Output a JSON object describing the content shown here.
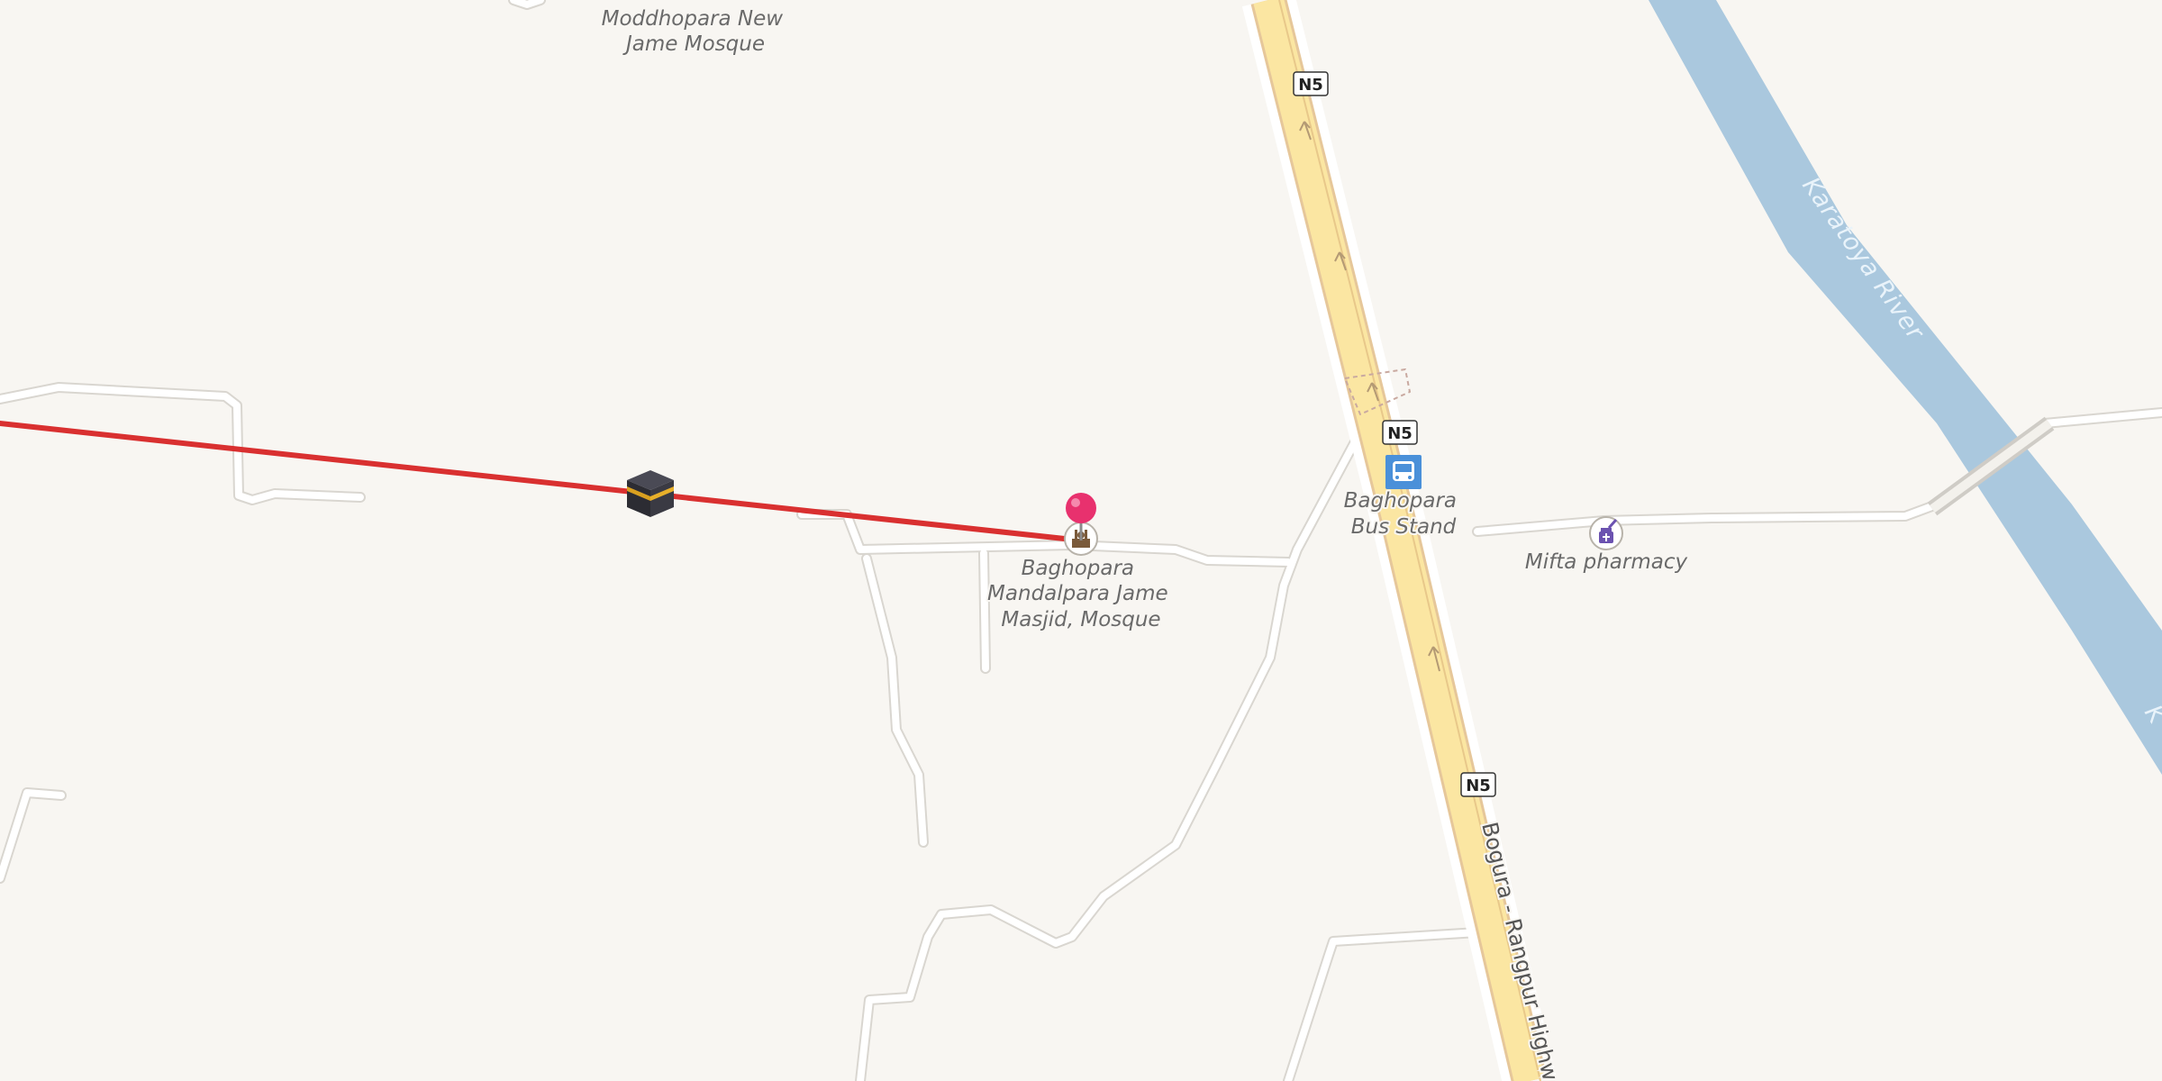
{
  "map": {
    "pois": {
      "moddhopara_mosque": "Moddhopara New Jame Mosque",
      "mandalpara_masjid": "Baghopara Mandalpara Jame Masjid, Mosque",
      "bus_stand": "Baghopara Bus Stand",
      "pharmacy": "Mifta pharmacy"
    },
    "road_names": {
      "highway": "Bogura - Rangpur Highway"
    },
    "road_refs": {
      "ref_top": "N5",
      "ref_mid": "N5",
      "ref_bottom": "N5"
    },
    "water": {
      "river": "Karatoya River",
      "river_edge": "K"
    },
    "icons": {
      "kaaba_marker": "kaaba-icon",
      "pin": "map-pin-icon",
      "mosque": "mosque-icon",
      "bus": "bus-icon",
      "pharmacy": "pharmacy-icon"
    },
    "colors": {
      "background": "#f8f6f2",
      "highway_fill": "#fbe6a2",
      "highway_casing": "#e6c79a",
      "river": "#aac8de",
      "route_line": "#d93030",
      "pin": "#e8316e",
      "bus_stop": "#4a90d9",
      "pharmacy": "#6b52b0",
      "road_fill": "#ffffff",
      "road_casing": "#d9d6d0"
    }
  }
}
